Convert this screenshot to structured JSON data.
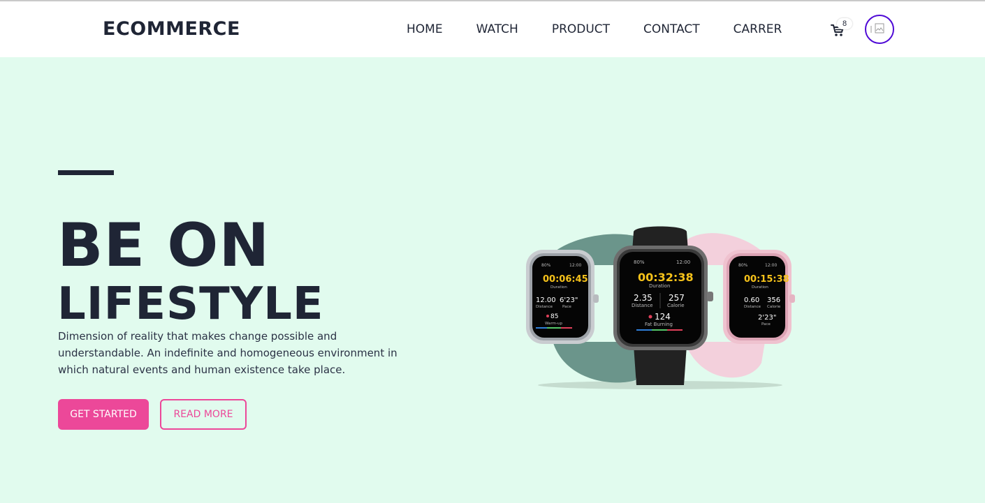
{
  "brand": "ECOMMERCE",
  "nav": {
    "items": [
      {
        "label": "HOME"
      },
      {
        "label": "WATCH"
      },
      {
        "label": "PRODUCT"
      },
      {
        "label": "CONTACT"
      },
      {
        "label": "CARRER"
      }
    ],
    "cart_count": "8",
    "cart_icon": "cart-icon",
    "avatar_icon": "broken-image-icon",
    "avatar_border_color": "#4f0ad6"
  },
  "hero": {
    "headline_line1": "BE ON",
    "headline_line2": "LIFESTYLE",
    "description": "Dimension of reality that makes change possible and understandable. An indefinite and homogeneous environment in which natural events and human existence take place.",
    "primary_button": "GET STARTED",
    "secondary_button": "READ MORE",
    "background_color": "#e1fbee",
    "accent_color": "#ec4899"
  },
  "watches": {
    "left": {
      "battery": "80%",
      "time": "12:00",
      "timer": "00:06:45",
      "duration_label": "Duration",
      "stat1_value": "12.00",
      "stat1_label": "Distance",
      "stat2_value": "6'23\"",
      "stat2_label": "Pace",
      "heart": "85",
      "heart_label": "Warm-up"
    },
    "center": {
      "battery": "80%",
      "time": "12:00",
      "timer": "00:32:38",
      "duration_label": "Duration",
      "stat1_value": "2.35",
      "stat1_label": "Distance",
      "stat2_value": "257",
      "stat2_label": "Calorie",
      "heart": "124",
      "heart_label": "Fat Burning"
    },
    "right": {
      "battery": "80%",
      "time": "12:00",
      "timer": "00:15:38",
      "duration_label": "Duration",
      "stat1_value": "0.60",
      "stat1_label": "Distance",
      "stat2_value": "356",
      "stat2_label": "Calorie",
      "stat3_value": "2'23\"",
      "stat3_label": "Pace"
    }
  }
}
